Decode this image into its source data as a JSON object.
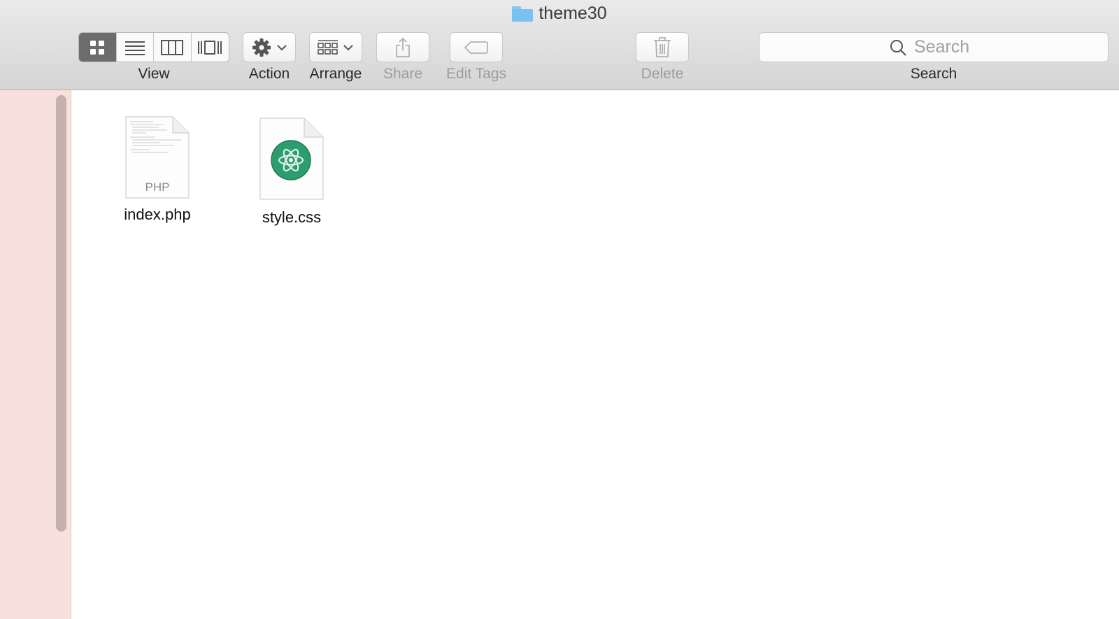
{
  "window": {
    "title": "theme30"
  },
  "toolbar": {
    "view_label": "View",
    "action_label": "Action",
    "arrange_label": "Arrange",
    "share_label": "Share",
    "edit_tags_label": "Edit Tags",
    "delete_label": "Delete",
    "search_label": "Search",
    "search_placeholder": "Search",
    "view_modes": [
      "icon",
      "list",
      "column",
      "cover-flow"
    ],
    "active_view": "icon"
  },
  "files": [
    {
      "name": "index.php",
      "type_badge": "PHP",
      "icon": "php-document-icon"
    },
    {
      "name": "style.css",
      "icon": "atom-document-icon",
      "accent": "#2e9d6e"
    }
  ],
  "colors": {
    "sidebar": "#f8e1dc",
    "active_segment": "#6c6c6c"
  }
}
